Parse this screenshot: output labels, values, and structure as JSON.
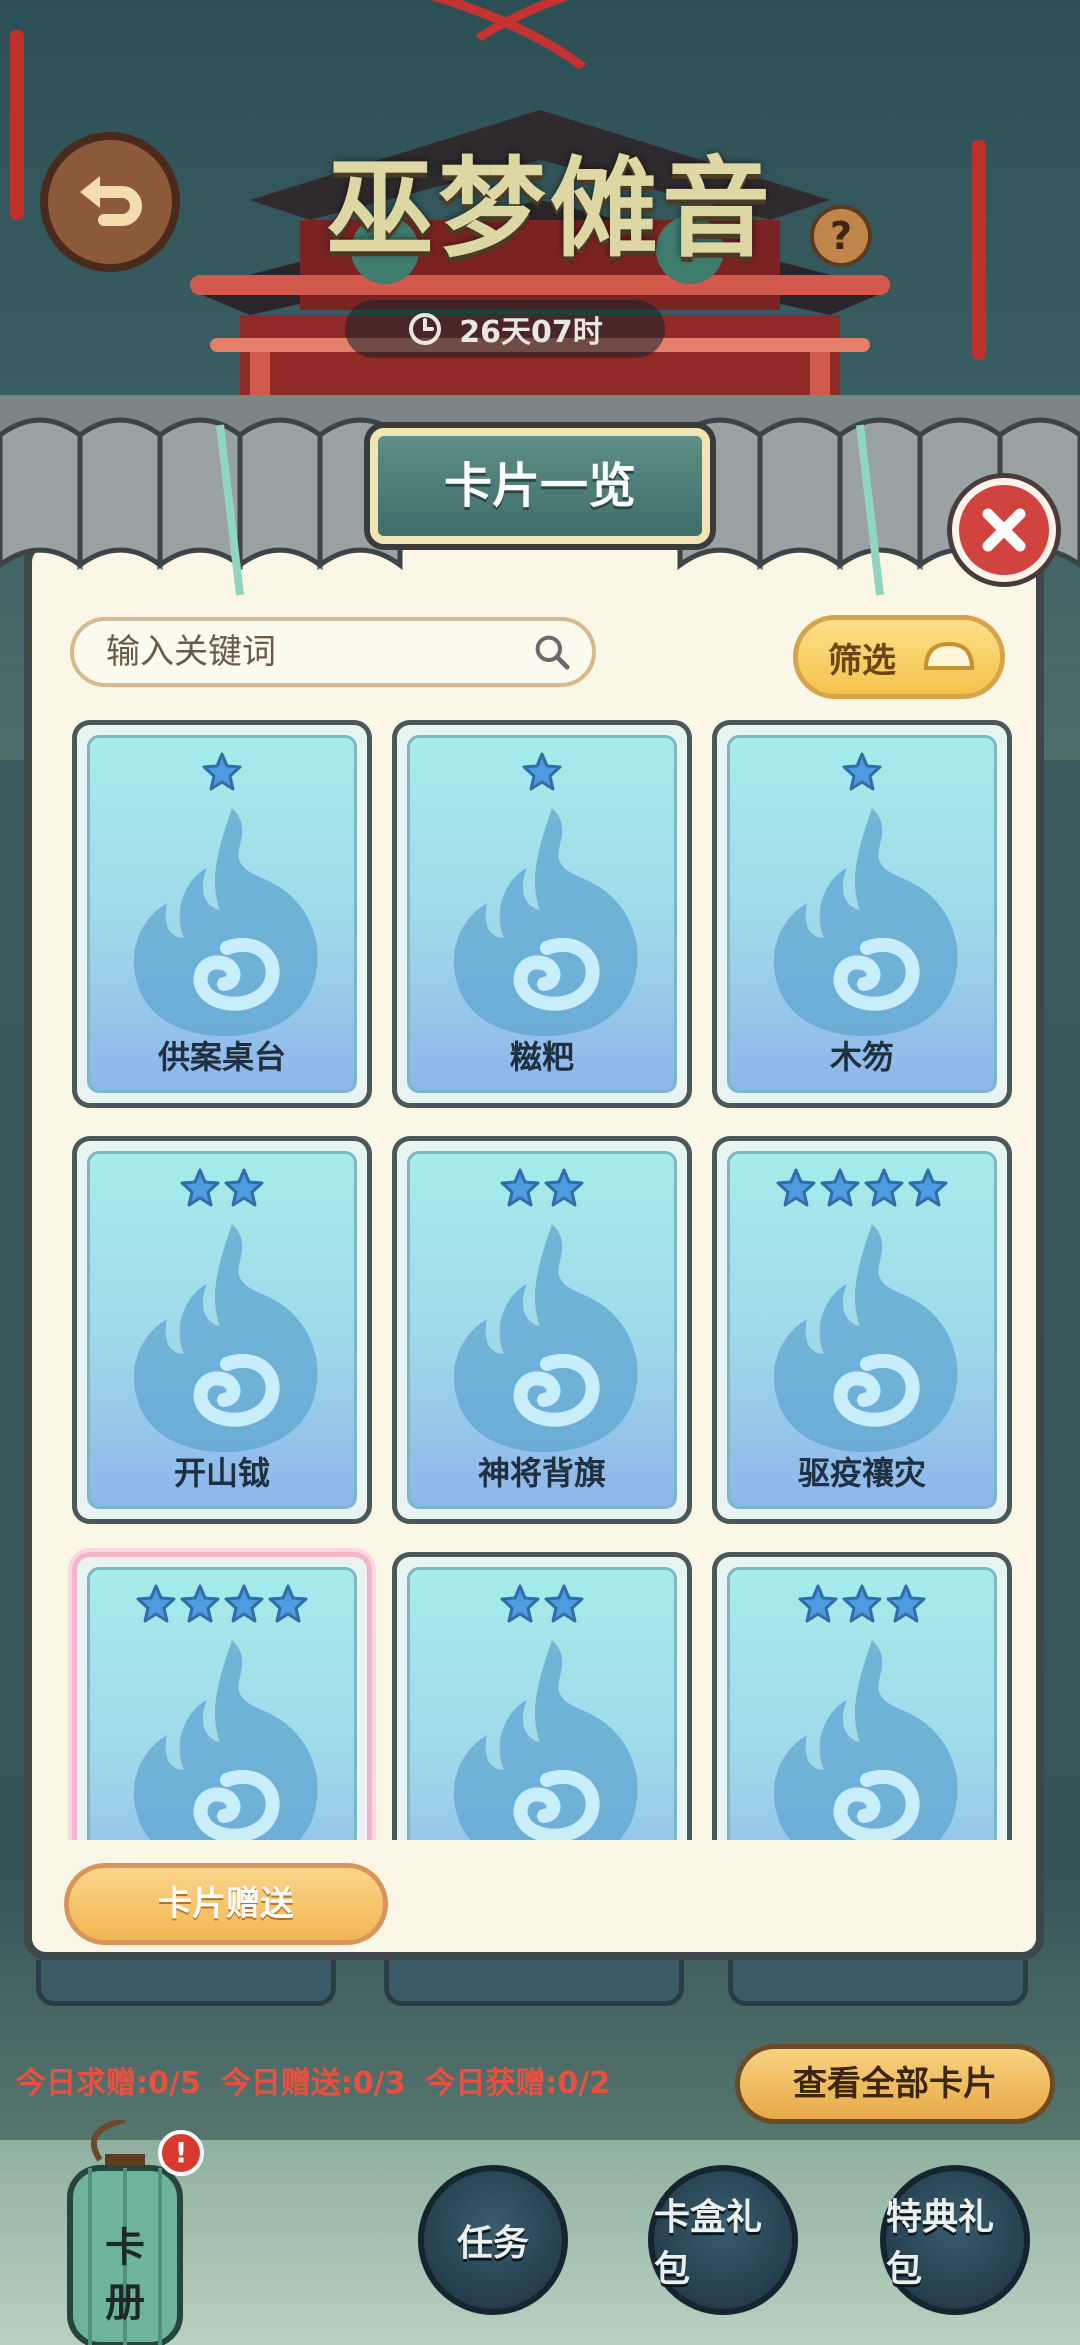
{
  "header": {
    "title": "巫梦傩音",
    "timer": "26天07时",
    "help_label": "?"
  },
  "dialog": {
    "title": "卡片一览",
    "search_placeholder": "输入关键词",
    "filter_label": "筛选",
    "gift_label": "卡片赠送"
  },
  "cards": [
    {
      "name": "供案桌台",
      "stars": 1
    },
    {
      "name": "糍粑",
      "stars": 1
    },
    {
      "name": "木笏",
      "stars": 1
    },
    {
      "name": "开山钺",
      "stars": 2
    },
    {
      "name": "神将背旗",
      "stars": 2
    },
    {
      "name": "驱疫禳灾",
      "stars": 4
    },
    {
      "name": "",
      "stars": 4
    },
    {
      "name": "",
      "stars": 2
    },
    {
      "name": "",
      "stars": 3
    }
  ],
  "footer": {
    "stat_request": "今日求赠:0/5",
    "stat_gift": "今日赠送:0/3",
    "stat_received": "今日获赠:0/2",
    "view_all_label": "查看全部卡片",
    "album_label_1": "卡",
    "album_label_2": "册",
    "album_badge": "!",
    "task_label": "任务",
    "box_gift_label": "卡盒礼包",
    "special_gift_label": "特典礼包"
  },
  "colors": {
    "accent": "#f3c24b",
    "panel": "#fbf7e6",
    "card_blue": "#9ed8ea",
    "danger": "#d0433e"
  }
}
